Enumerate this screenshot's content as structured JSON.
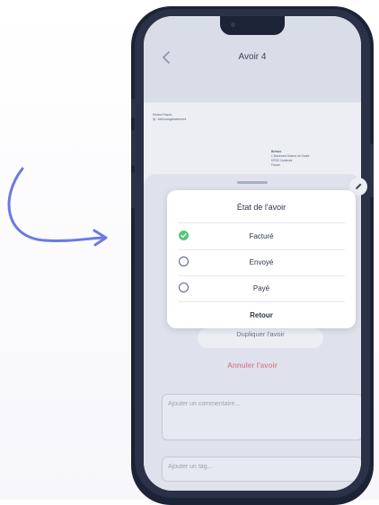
{
  "screen": {
    "title": "Avoir 4",
    "document": {
      "sender_lines": [
        "Sindoni Paquin",
        "@ : bebloucagedatesment"
      ],
      "recipient_lines": [
        "Bertaro",
        "1 Boulevard Diderot de Gaulle",
        "67000 Cambrais",
        "France"
      ]
    },
    "duplicate_button_label": "Dupliquer l'avoir",
    "cancel_link_label": "Annuler l'avoir",
    "comment_placeholder": "Ajouter un commentaire...",
    "tag_placeholder": "Ajouter un tag..."
  },
  "modal": {
    "title": "État de l'avoir",
    "options": [
      {
        "label": "Facturé",
        "selected": true
      },
      {
        "label": "Envoyé",
        "selected": false
      },
      {
        "label": "Payé",
        "selected": false
      }
    ],
    "back_label": "Retour"
  },
  "colors": {
    "accent_green": "#55c77a",
    "cancel_pink": "#d68a99",
    "phone_frame": "#2b3247",
    "arrow_blue": "#6b78e5"
  },
  "icons": [
    "back-chevron-icon",
    "pencil-icon",
    "check-icon",
    "curved-arrow-icon"
  ]
}
